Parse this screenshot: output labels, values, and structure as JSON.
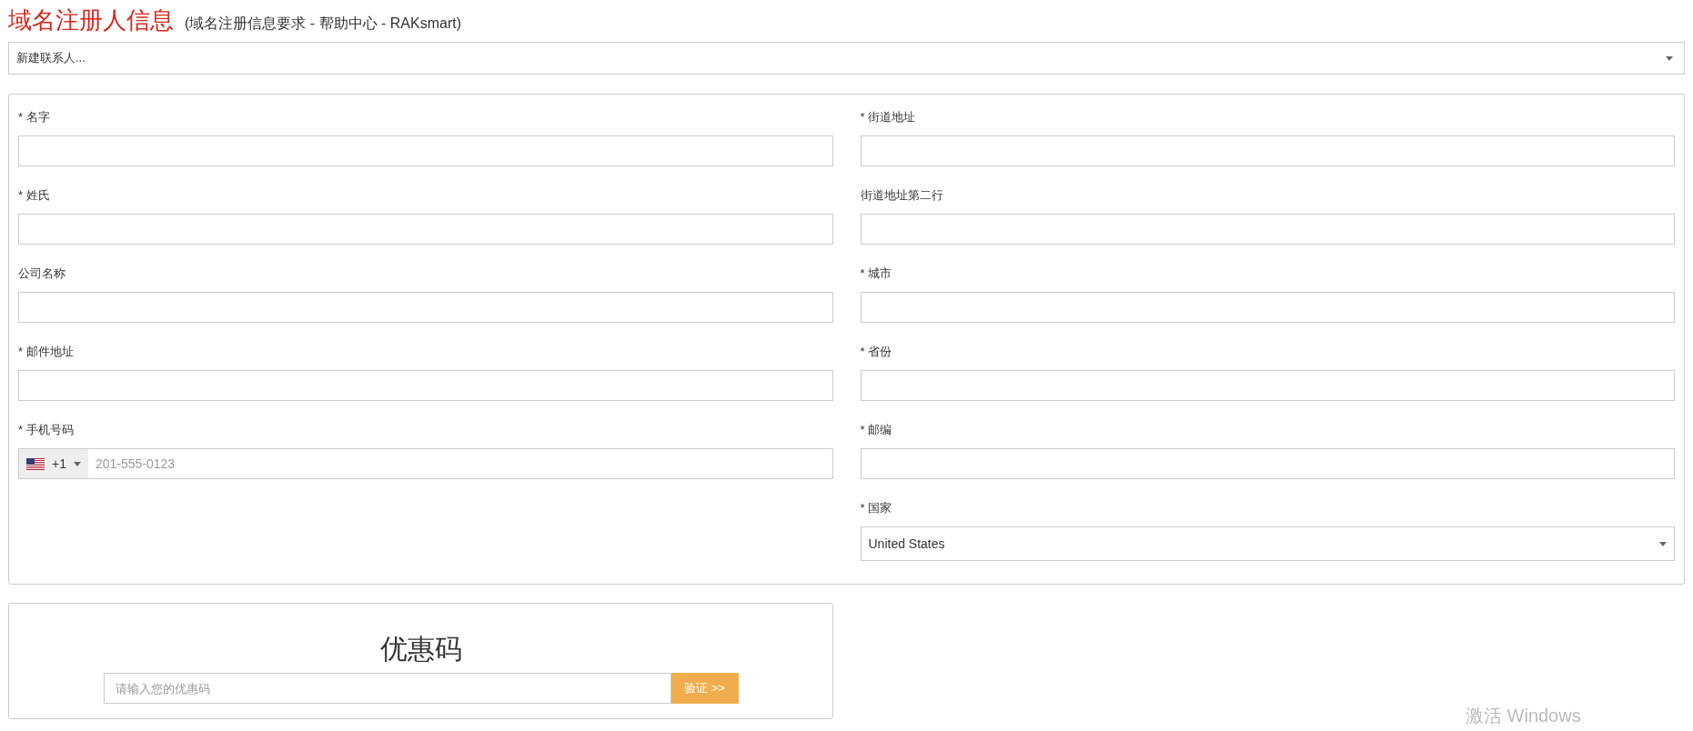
{
  "header": {
    "title": "域名注册人信息",
    "subtitle": "(域名注册信息要求 - 帮助中心 - RAKsmart)"
  },
  "contact_select": {
    "value": "新建联系人..."
  },
  "form": {
    "columns": [
      {
        "fields": [
          {
            "kind": "text",
            "label": "* 名字"
          },
          {
            "kind": "text",
            "label": "* 姓氏"
          },
          {
            "kind": "text",
            "label": "公司名称"
          },
          {
            "kind": "text",
            "label": "* 邮件地址"
          },
          {
            "kind": "phone",
            "label": "* 手机号码",
            "dial_code": "+1",
            "placeholder": "201-555-0123"
          }
        ]
      },
      {
        "fields": [
          {
            "kind": "text",
            "label": "* 街道地址"
          },
          {
            "kind": "text",
            "label": "街道地址第二行"
          },
          {
            "kind": "text",
            "label": "* 城市"
          },
          {
            "kind": "text",
            "label": "* 省份"
          },
          {
            "kind": "text",
            "label": "* 邮编"
          },
          {
            "kind": "select",
            "label": "* 国家",
            "value": "United States"
          }
        ]
      }
    ]
  },
  "coupon": {
    "title": "优惠码",
    "placeholder": "请输入您的优惠码",
    "button": "验证 >>"
  },
  "os_overlay": {
    "text": "激活 Windows"
  }
}
